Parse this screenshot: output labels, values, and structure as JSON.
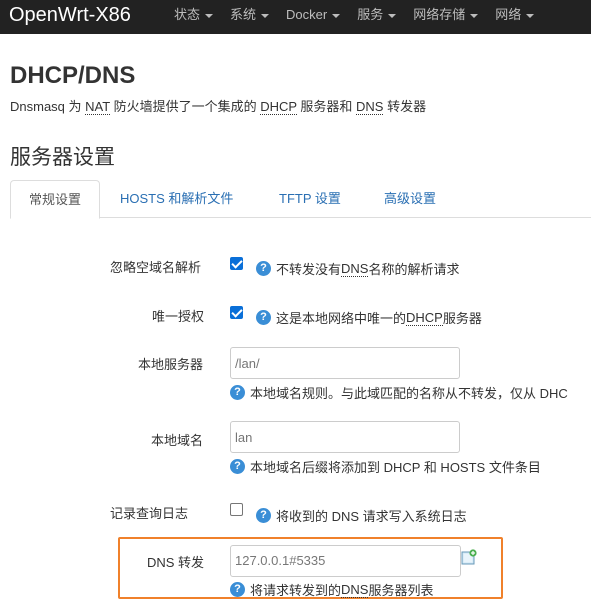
{
  "navbar": {
    "brand": "OpenWrt-X86",
    "menu": [
      "状态",
      "系统",
      "Docker",
      "服务",
      "网络存储",
      "网络"
    ]
  },
  "page": {
    "title": "DHCP/DNS",
    "description_parts": [
      "Dnsmasq 为 ",
      "NAT",
      " 防火墙提供了一个集成的 ",
      "DHCP",
      " 服务器和 ",
      "DNS",
      " 转发器"
    ]
  },
  "section_title": "服务器设置",
  "tabs": [
    "常规设置",
    "HOSTS 和解析文件",
    "TFTP 设置",
    "高级设置"
  ],
  "fields": {
    "ignore_empty": {
      "label": "忽略空域名解析",
      "checked": true,
      "help_parts": [
        "不转发没有 ",
        "DNS",
        " 名称的解析请求"
      ]
    },
    "authoritative": {
      "label": "唯一授权",
      "checked": true,
      "help_parts": [
        "这是本地网络中唯一的 ",
        "DHCP",
        " 服务器"
      ]
    },
    "local_server": {
      "label": "本地服务器",
      "placeholder": "/lan/",
      "help": "本地域名规则。与此域匹配的名称从不转发，仅从 DHC"
    },
    "local_domain": {
      "label": "本地域名",
      "placeholder": "lan",
      "help": "本地域名后缀将添加到 DHCP 和 HOSTS 文件条目"
    },
    "log_queries": {
      "label": "记录查询日志",
      "checked": false,
      "help": "将收到的 DNS 请求写入系统日志"
    },
    "dns_forward": {
      "label": "DNS 转发",
      "value": "127.0.0.1#5335",
      "help_parts": [
        "将请求转发到的 ",
        "DNS",
        " 服务器列表"
      ]
    }
  },
  "colors": {
    "navbar_bg": "#222222",
    "link": "#2a6fb3",
    "checkbox": "#0a6fd8",
    "help_icon": "#3a8ed6",
    "highlight": "#f0812b"
  }
}
